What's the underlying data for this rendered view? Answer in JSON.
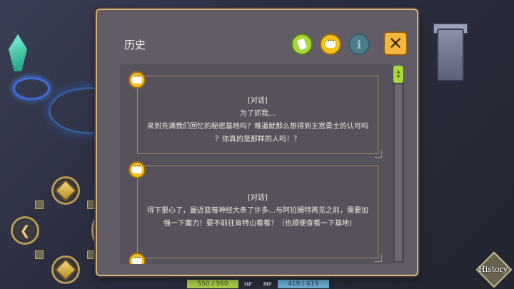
{
  "panel": {
    "title": "历史",
    "entries": [
      {
        "tag": "[对话]",
        "lines": [
          "为了抓我…",
          "来到充满我们回忆的秘密基地吗？难道就那么想得到王宫勇士的认可吗",
          "？你真的是那样的人吗！？"
        ]
      },
      {
        "tag": "[对话]",
        "lines": [
          "得下狠心了，最近蓝莓神经大条了许多…与阿拉姆特再见之前，需要加",
          "强一下魔力！要不前往肯特山看看？（也顺便查看一下基地)"
        ]
      }
    ],
    "info_glyph": "i",
    "close_glyph": "✕"
  },
  "status": {
    "hp_value": "550 / 560",
    "hp_label": "HP",
    "mp_label": "MP",
    "mp_value": "419 / 419"
  },
  "history_button": "History",
  "colors": {
    "panel_border": "#d9b46a",
    "hp": "#a7c94a",
    "mp": "#6aa6c9",
    "accent_yellow": "#f4c021",
    "accent_green": "#a6d83a"
  },
  "icons": [
    "log-icon",
    "chat-icon",
    "info-icon",
    "close-icon",
    "dpad-up-icon",
    "dpad-left-icon",
    "dpad-down-icon",
    "dpad-right-icon"
  ]
}
